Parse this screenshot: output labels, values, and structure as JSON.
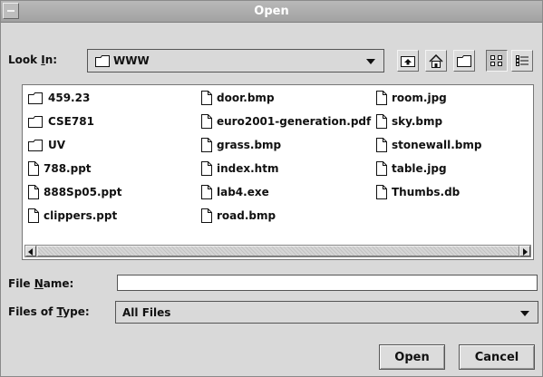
{
  "window": {
    "title": "Open"
  },
  "lookin": {
    "label_pre": "Look ",
    "label_mnemonic": "I",
    "label_post": "n:",
    "value": "WWW"
  },
  "toolbar": [
    "up-one-level",
    "home",
    "new-folder",
    "list-view",
    "details-view"
  ],
  "files": [
    {
      "name": "459.23",
      "type": "folder"
    },
    {
      "name": "CSE781",
      "type": "folder"
    },
    {
      "name": "UV",
      "type": "folder"
    },
    {
      "name": "788.ppt",
      "type": "file"
    },
    {
      "name": "888Sp05.ppt",
      "type": "file"
    },
    {
      "name": "clippers.ppt",
      "type": "file"
    },
    {
      "name": "door.bmp",
      "type": "file"
    },
    {
      "name": "euro2001-generation.pdf",
      "type": "file"
    },
    {
      "name": "grass.bmp",
      "type": "file"
    },
    {
      "name": "index.htm",
      "type": "file"
    },
    {
      "name": "lab4.exe",
      "type": "file"
    },
    {
      "name": "road.bmp",
      "type": "file"
    },
    {
      "name": "room.jpg",
      "type": "file"
    },
    {
      "name": "sky.bmp",
      "type": "file"
    },
    {
      "name": "stonewall.bmp",
      "type": "file"
    },
    {
      "name": "table.jpg",
      "type": "file"
    },
    {
      "name": "Thumbs.db",
      "type": "file"
    }
  ],
  "filename": {
    "label_pre": "File ",
    "label_mnemonic": "N",
    "label_post": "ame:",
    "value": ""
  },
  "filetype": {
    "label_pre": "Files of ",
    "label_mnemonic": "T",
    "label_post": "ype:",
    "value": "All Files"
  },
  "buttons": {
    "open": "Open",
    "cancel": "Cancel"
  }
}
